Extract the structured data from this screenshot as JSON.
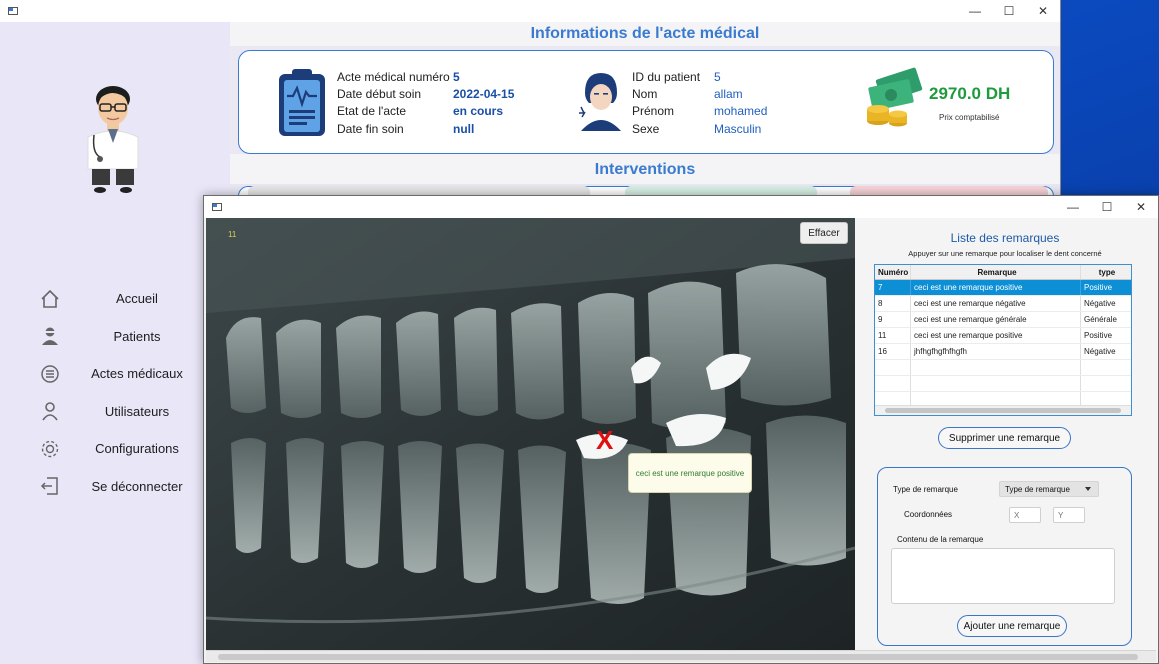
{
  "main_window": {
    "controls": {
      "minimize": "—",
      "maximize": "☐",
      "close": "✕"
    },
    "sidebar": {
      "items": [
        {
          "label": "Accueil",
          "icon": "home-icon"
        },
        {
          "label": "Patients",
          "icon": "patient-icon"
        },
        {
          "label": "Actes médicaux",
          "icon": "list-circle-icon"
        },
        {
          "label": "Utilisateurs",
          "icon": "user-icon"
        },
        {
          "label": "Configurations",
          "icon": "gear-icon"
        },
        {
          "label": "Se déconnecter",
          "icon": "logout-icon"
        }
      ]
    },
    "info_title": "Informations de l'acte médical",
    "acte": {
      "numero_label": "Acte médical numéro",
      "numero": "5",
      "debut_label": "Date début soin",
      "debut": "2022-04-15",
      "etat_label": "Etat de l'acte",
      "etat": "en cours",
      "fin_label": "Date fin soin",
      "fin": "null"
    },
    "patient": {
      "id_label": "ID du patient",
      "id": "5",
      "nom_label": "Nom",
      "nom": "allam",
      "prenom_label": "Prénom",
      "prenom": "mohamed",
      "sexe_label": "Sexe",
      "sexe": "Masculin"
    },
    "prix": {
      "montant": "2970.0 DH",
      "label": "Prix comptabilisé"
    },
    "interventions_title": "Interventions"
  },
  "popup": {
    "controls": {
      "minimize": "—",
      "maximize": "☐",
      "close": "✕"
    },
    "xray": {
      "counter": "11",
      "clear_button": "Effacer",
      "marker": "X",
      "tooltip": "ceci est une remarque positive"
    },
    "remarks": {
      "title": "Liste des remarques",
      "subtitle": "Appuyer sur une remarque pour localiser le dent concerné",
      "columns": [
        "Numéro",
        "Remarque",
        "type"
      ],
      "rows": [
        {
          "num": "7",
          "text": "ceci est une remarque positive",
          "type": "Positive",
          "selected": true
        },
        {
          "num": "8",
          "text": "ceci est une remarque négative",
          "type": "Négative",
          "selected": false
        },
        {
          "num": "9",
          "text": "ceci est une remarque générale",
          "type": "Générale",
          "selected": false
        },
        {
          "num": "11",
          "text": "ceci est une remarque positive",
          "type": "Positive",
          "selected": false
        },
        {
          "num": "16",
          "text": "jhfhgfhgfhfhgfh",
          "type": "Négative",
          "selected": false
        }
      ],
      "delete_button": "Supprimer une remarque"
    },
    "form": {
      "type_label": "Type de remarque",
      "type_select": "Type de remarque",
      "coords_label": "Coordonnées",
      "x_placeholder": "X",
      "y_placeholder": "Y",
      "content_label": "Contenu de la remarque",
      "add_button": "Ajouter une remarque"
    }
  },
  "colors": {
    "accent": "#3a7bd0",
    "selected_row": "#0d8fd6",
    "money": "#1f9a3c",
    "marker": "#e01010"
  }
}
